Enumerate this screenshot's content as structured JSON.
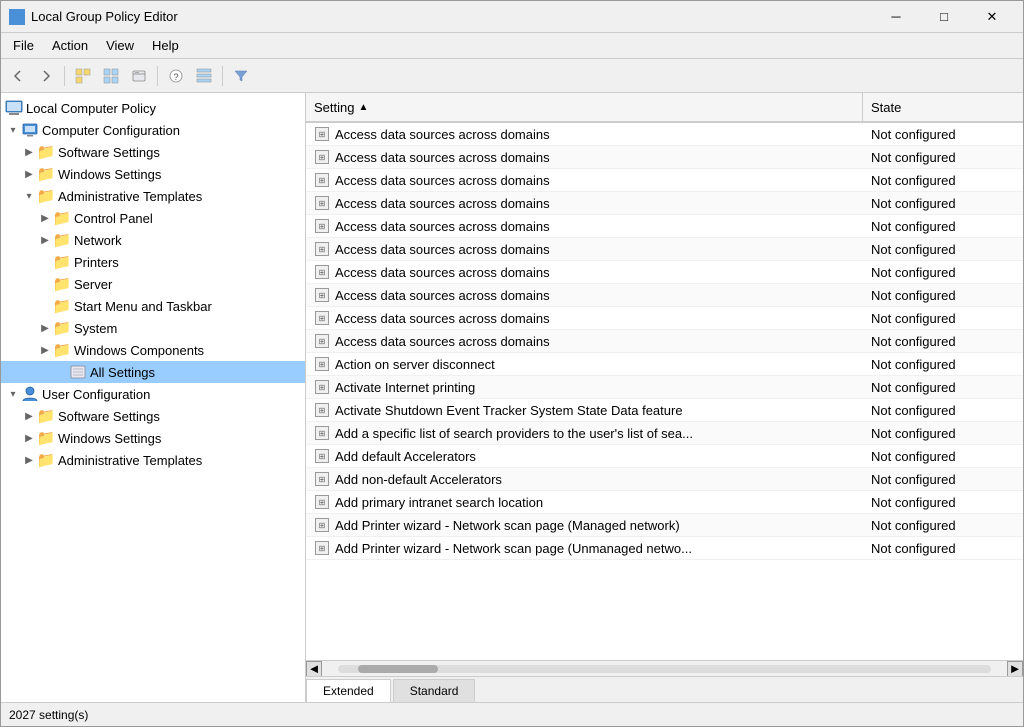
{
  "window": {
    "title": "Local Group Policy Editor",
    "icon": "📋"
  },
  "titleBar": {
    "title": "Local Group Policy Editor",
    "minimizeLabel": "─",
    "maximizeLabel": "□",
    "closeLabel": "✕"
  },
  "menuBar": {
    "items": [
      "File",
      "Action",
      "View",
      "Help"
    ]
  },
  "toolbar": {
    "buttons": [
      "←",
      "→",
      "🗂",
      "▦",
      "📄",
      "❓",
      "▦",
      "▼"
    ]
  },
  "tree": {
    "root": "Local Computer Policy",
    "items": [
      {
        "id": "computer-config",
        "label": "Computer Configuration",
        "level": 1,
        "expanded": true,
        "icon": "computer",
        "hasToggle": true,
        "toggleState": "expanded"
      },
      {
        "id": "software-settings-1",
        "label": "Software Settings",
        "level": 2,
        "expanded": false,
        "icon": "folder",
        "hasToggle": true,
        "toggleState": "collapsed"
      },
      {
        "id": "windows-settings-1",
        "label": "Windows Settings",
        "level": 2,
        "expanded": false,
        "icon": "folder",
        "hasToggle": true,
        "toggleState": "collapsed"
      },
      {
        "id": "admin-templates",
        "label": "Administrative Templates",
        "level": 2,
        "expanded": true,
        "icon": "folder",
        "hasToggle": true,
        "toggleState": "expanded"
      },
      {
        "id": "control-panel",
        "label": "Control Panel",
        "level": 3,
        "expanded": false,
        "icon": "folder",
        "hasToggle": true,
        "toggleState": "collapsed"
      },
      {
        "id": "network",
        "label": "Network",
        "level": 3,
        "expanded": false,
        "icon": "folder",
        "hasToggle": true,
        "toggleState": "collapsed"
      },
      {
        "id": "printers",
        "label": "Printers",
        "level": 3,
        "expanded": false,
        "icon": "folder",
        "hasToggle": false
      },
      {
        "id": "server",
        "label": "Server",
        "level": 3,
        "expanded": false,
        "icon": "folder",
        "hasToggle": false
      },
      {
        "id": "start-menu",
        "label": "Start Menu and Taskbar",
        "level": 3,
        "expanded": false,
        "icon": "folder",
        "hasToggle": false
      },
      {
        "id": "system",
        "label": "System",
        "level": 3,
        "expanded": false,
        "icon": "folder",
        "hasToggle": true,
        "toggleState": "collapsed"
      },
      {
        "id": "windows-components",
        "label": "Windows Components",
        "level": 3,
        "expanded": false,
        "icon": "folder",
        "hasToggle": true,
        "toggleState": "collapsed"
      },
      {
        "id": "all-settings",
        "label": "All Settings",
        "level": 4,
        "expanded": false,
        "icon": "settings",
        "hasToggle": false,
        "selected": true
      },
      {
        "id": "user-config",
        "label": "User Configuration",
        "level": 1,
        "expanded": true,
        "icon": "user",
        "hasToggle": true,
        "toggleState": "expanded"
      },
      {
        "id": "software-settings-2",
        "label": "Software Settings",
        "level": 2,
        "expanded": false,
        "icon": "folder",
        "hasToggle": true,
        "toggleState": "collapsed"
      },
      {
        "id": "windows-settings-2",
        "label": "Windows Settings",
        "level": 2,
        "expanded": false,
        "icon": "folder",
        "hasToggle": true,
        "toggleState": "collapsed"
      },
      {
        "id": "admin-templates-2",
        "label": "Administrative Templates",
        "level": 2,
        "expanded": false,
        "icon": "folder",
        "hasToggle": true,
        "toggleState": "collapsed"
      }
    ]
  },
  "table": {
    "columns": [
      {
        "id": "setting",
        "label": "Setting",
        "sortArrow": "▲"
      },
      {
        "id": "state",
        "label": "State"
      }
    ],
    "rows": [
      {
        "setting": "Access data sources across domains",
        "state": "Not configured"
      },
      {
        "setting": "Access data sources across domains",
        "state": "Not configured"
      },
      {
        "setting": "Access data sources across domains",
        "state": "Not configured"
      },
      {
        "setting": "Access data sources across domains",
        "state": "Not configured"
      },
      {
        "setting": "Access data sources across domains",
        "state": "Not configured"
      },
      {
        "setting": "Access data sources across domains",
        "state": "Not configured"
      },
      {
        "setting": "Access data sources across domains",
        "state": "Not configured"
      },
      {
        "setting": "Access data sources across domains",
        "state": "Not configured"
      },
      {
        "setting": "Access data sources across domains",
        "state": "Not configured"
      },
      {
        "setting": "Access data sources across domains",
        "state": "Not configured"
      },
      {
        "setting": "Action on server disconnect",
        "state": "Not configured"
      },
      {
        "setting": "Activate Internet printing",
        "state": "Not configured"
      },
      {
        "setting": "Activate Shutdown Event Tracker System State Data feature",
        "state": "Not configured"
      },
      {
        "setting": "Add a specific list of search providers to the user's list of sea...",
        "state": "Not configured"
      },
      {
        "setting": "Add default Accelerators",
        "state": "Not configured"
      },
      {
        "setting": "Add non-default Accelerators",
        "state": "Not configured"
      },
      {
        "setting": "Add primary intranet search location",
        "state": "Not configured"
      },
      {
        "setting": "Add Printer wizard - Network scan page (Managed network)",
        "state": "Not configured"
      },
      {
        "setting": "Add Printer wizard - Network scan page (Unmanaged netwo...",
        "state": "Not configured"
      }
    ]
  },
  "tabs": [
    {
      "id": "extended",
      "label": "Extended",
      "active": true
    },
    {
      "id": "standard",
      "label": "Standard",
      "active": false
    }
  ],
  "statusBar": {
    "text": "2027 setting(s)"
  }
}
